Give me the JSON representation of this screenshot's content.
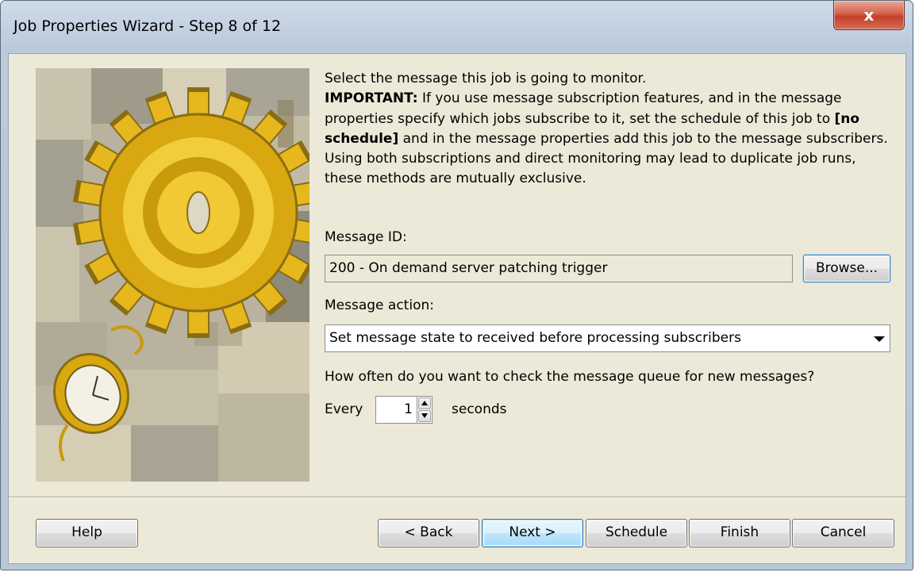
{
  "window": {
    "title": "Job Properties Wizard - Step 8 of 12",
    "close_label": "x"
  },
  "intro": {
    "line1": "Select the message this job is going to monitor.",
    "important_label": "IMPORTANT:",
    "text_a": " If you use message subscription features, and in the message properties specify which jobs subscribe to it, set the schedule of this job to ",
    "no_schedule": "[no schedule]",
    "text_b": " and in the message properties add this job to the message subscribers. Using both subscriptions and direct monitoring may lead to duplicate job runs, these methods are mutually exclusive."
  },
  "message_id": {
    "label": "Message ID:",
    "value": "200 - On demand server patching trigger",
    "browse_label": "Browse..."
  },
  "message_action": {
    "label": "Message action:",
    "value": "Set message state to received before processing subscribers"
  },
  "check_interval": {
    "question": "How often do you want to check the message queue for new messages?",
    "every_label": "Every",
    "value": "1",
    "unit_label": "seconds"
  },
  "buttons": {
    "help": "Help",
    "back": "< Back",
    "next": "Next >",
    "schedule": "Schedule",
    "finish": "Finish",
    "cancel": "Cancel"
  },
  "colors": {
    "dialog_bg": "#ece9d8",
    "titlebar": "#b9cadb",
    "close_red": "#c1402a",
    "default_button_border": "#3c7fb1"
  },
  "icons": [
    "close-icon",
    "gear-icon",
    "pocket-watch-icon",
    "chevron-down-icon",
    "spin-up-icon",
    "spin-down-icon"
  ]
}
